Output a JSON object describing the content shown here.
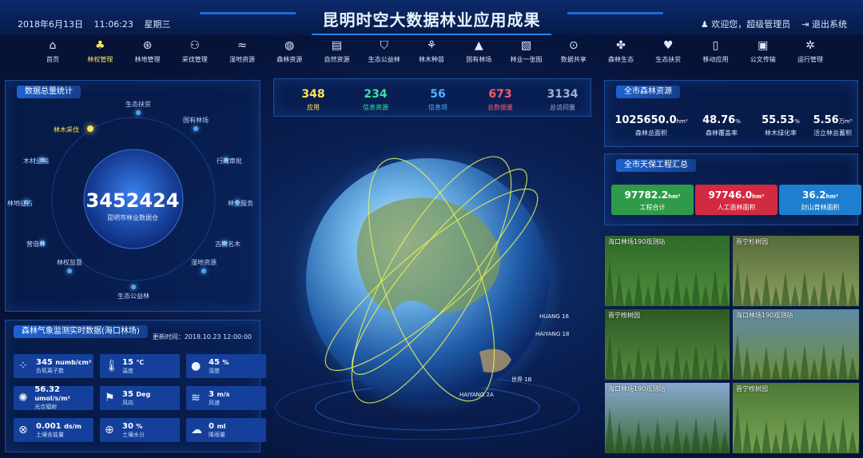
{
  "header": {
    "date": "2018年6月13日",
    "time": "11:06:23",
    "weekday": "星期三",
    "title": "昆明时空大数据林业应用成果",
    "user": "欢迎您，超级管理员",
    "logout": "退出系统"
  },
  "nav": [
    {
      "label": "首页",
      "icon": "home-icon",
      "glyph": "⌂"
    },
    {
      "label": "林权管理",
      "icon": "tree-icon",
      "glyph": "♣",
      "active": true
    },
    {
      "label": "林地管理",
      "icon": "land-icon",
      "glyph": "⊛"
    },
    {
      "label": "采伐管理",
      "icon": "users-icon",
      "glyph": "⚇"
    },
    {
      "label": "湿地资源",
      "icon": "wetland-icon",
      "glyph": "≈"
    },
    {
      "label": "森林资源",
      "icon": "globe-icon",
      "glyph": "◍"
    },
    {
      "label": "自然资源",
      "icon": "document-icon",
      "glyph": "▤"
    },
    {
      "label": "生态公益林",
      "icon": "shield-icon",
      "glyph": "⛉"
    },
    {
      "label": "林木种苗",
      "icon": "sprout-icon",
      "glyph": "⚘"
    },
    {
      "label": "国有林场",
      "icon": "mountain-icon",
      "glyph": "▲"
    },
    {
      "label": "林业一张图",
      "icon": "map-icon",
      "glyph": "▧"
    },
    {
      "label": "数据共享",
      "icon": "location-icon",
      "glyph": "⊙"
    },
    {
      "label": "森林生态",
      "icon": "flower-icon",
      "glyph": "✤"
    },
    {
      "label": "生态扶贫",
      "icon": "hand-heart-icon",
      "glyph": "♥"
    },
    {
      "label": "移动应用",
      "icon": "phone-icon",
      "glyph": "▯"
    },
    {
      "label": "公文传输",
      "icon": "office-icon",
      "glyph": "▣"
    },
    {
      "label": "运行管理",
      "icon": "gears-icon",
      "glyph": "✲"
    }
  ],
  "left_top": {
    "title": "数据总量统计",
    "center_value": "3452424",
    "center_label": "昆明市林业数据仓",
    "nodes": [
      "生态扶贫",
      "国有林场",
      "行政审批",
      "林业服务",
      "古树名木",
      "湿地资源",
      "生态公益林",
      "林权监督",
      "营造林",
      "林地征占",
      "木材运输",
      "林木采伐"
    ]
  },
  "left_bottom": {
    "title": "森林气象监测实时数据(海口林场)",
    "update": "更新时间：2018.10.23 12:00:00",
    "items": [
      {
        "value": "345",
        "unit": "numb/cm³",
        "label": "负氧离子数",
        "icon": "particles-icon",
        "glyph": "⁘"
      },
      {
        "value": "15",
        "unit": "℃",
        "label": "温度",
        "icon": "thermometer-icon",
        "glyph": "🌡"
      },
      {
        "value": "45",
        "unit": "%",
        "label": "湿度",
        "icon": "droplet-icon",
        "glyph": "●"
      },
      {
        "value": "56.32",
        "unit": "umol/s/m²",
        "label": "光合辐射",
        "icon": "radiation-icon",
        "glyph": "✺"
      },
      {
        "value": "35",
        "unit": "Deg",
        "label": "风向",
        "icon": "wind-flag-icon",
        "glyph": "⚑"
      },
      {
        "value": "3",
        "unit": "m/s",
        "label": "风速",
        "icon": "wind-icon",
        "glyph": "≋"
      },
      {
        "value": "0.001",
        "unit": "ds/m",
        "label": "土壤含盐量",
        "icon": "salinity-icon",
        "glyph": "⊗"
      },
      {
        "value": "30",
        "unit": "%",
        "label": "土壤水分",
        "icon": "soil-water-icon",
        "glyph": "⊕"
      },
      {
        "value": "0",
        "unit": "ml",
        "label": "降雨量",
        "icon": "rain-cloud-icon",
        "glyph": "☁"
      }
    ]
  },
  "center_stats": [
    {
      "value": "348",
      "label": "应用",
      "color": "#ffe35a"
    },
    {
      "value": "234",
      "label": "信息资源",
      "color": "#39e0a6"
    },
    {
      "value": "56",
      "label": "信息项",
      "color": "#4fb2ff"
    },
    {
      "value": "673",
      "label": "总数据量",
      "color": "#ff5a6e"
    },
    {
      "value": "3134",
      "label": "总访问量",
      "color": "#9fb0d8"
    }
  ],
  "globe_labels": [
    "HUANG 16",
    "HAIYANG 18",
    "HAIYANG 2A",
    "世界·1B"
  ],
  "right_top": {
    "title": "全市森林资源",
    "items": [
      {
        "value": "1025650.0",
        "unit": "hm²",
        "label": "森林总面积"
      },
      {
        "value": "48.76",
        "unit": "%",
        "label": "森林覆盖率"
      },
      {
        "value": "55.53",
        "unit": "%",
        "label": "林木绿化率"
      },
      {
        "value": "5.56",
        "unit": "万m³",
        "label": "活立林总蓄积"
      }
    ]
  },
  "right_mid": {
    "title": "全市天保工程汇总",
    "cards": [
      {
        "value": "97782.2",
        "unit": "hm²",
        "label": "工程合计",
        "color": "#2f9b4a"
      },
      {
        "value": "97746.0",
        "unit": "hm²",
        "label": "人工造林面积",
        "color": "#d22a41"
      },
      {
        "value": "36.2",
        "unit": "hm²",
        "label": "封山育林面积",
        "color": "#1e7fd0"
      }
    ]
  },
  "photos": [
    {
      "caption": "海口林场190观测站",
      "c1": "#2f6a2a",
      "c2": "#4f8f3b"
    },
    {
      "caption": "晋宁杉树园",
      "c1": "#556b3a",
      "c2": "#8ea060"
    },
    {
      "caption": "晋宁桉树园",
      "c1": "#2c5a24",
      "c2": "#5a8a40"
    },
    {
      "caption": "海口林场190观测站",
      "c1": "#5f8aa5",
      "c2": "#6e8d3e"
    },
    {
      "caption": "海口林场190观测站",
      "c1": "#86a8cf",
      "c2": "#3d6b32"
    },
    {
      "caption": "晋宁桉树园",
      "c1": "#4c7a35",
      "c2": "#7aa355"
    }
  ]
}
